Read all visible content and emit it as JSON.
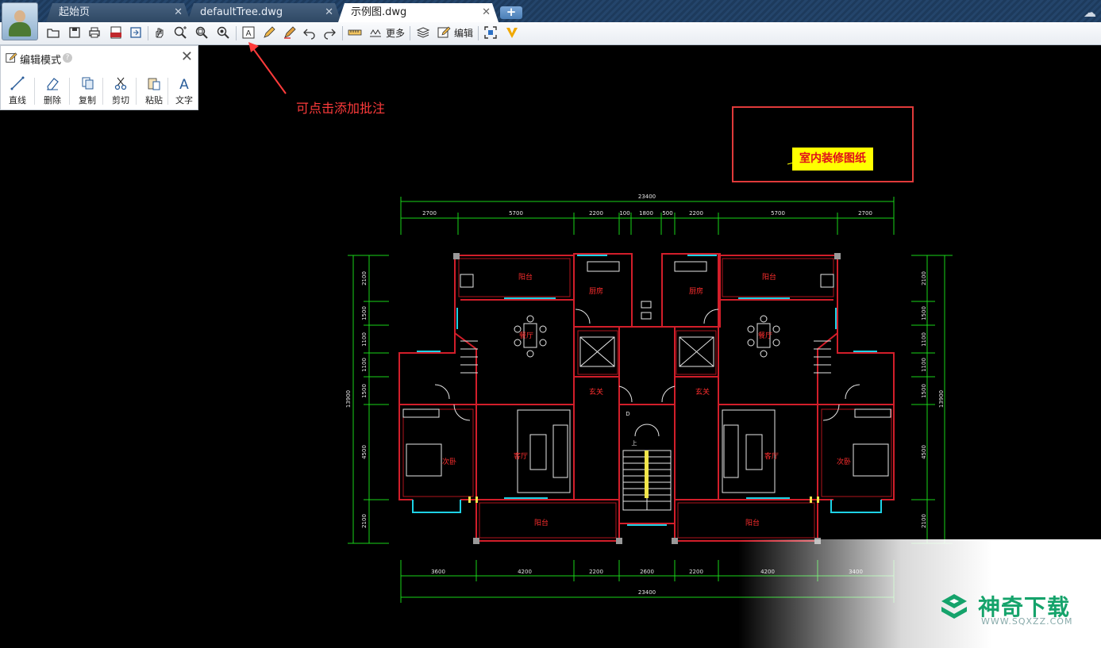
{
  "tabs": [
    {
      "label": "起始页",
      "close": "✕",
      "active": false
    },
    {
      "label": "defaultTree.dwg",
      "close": "✕",
      "active": false
    },
    {
      "label": "示例图.dwg",
      "close": "✕",
      "active": true
    }
  ],
  "toolbar": {
    "more_label": "更多",
    "edit_label": "编辑"
  },
  "edit_panel": {
    "title": "编辑模式",
    "help": "?",
    "close": "✕",
    "tools": [
      "直线",
      "删除",
      "复制",
      "剪切",
      "粘贴",
      "文字"
    ]
  },
  "annotation": {
    "hint": "可点击添加批注",
    "stamp": "室内装修图纸",
    "color": "#ff3b3b"
  },
  "drawing": {
    "top_total": "23400",
    "top_dims": [
      "2700",
      "5700",
      "2200",
      "100",
      "1800",
      "500",
      "2200",
      "5700",
      "2700"
    ],
    "bottom_total": "23400",
    "bottom_dims": [
      "3600",
      "4200",
      "2200",
      "2600",
      "2200",
      "4200",
      "3400"
    ],
    "left_total": "13900",
    "left_dims": [
      "2100",
      "1500",
      "1100",
      "1100",
      "1500",
      "4500",
      "2100"
    ],
    "right_total": "13900",
    "right_dims": [
      "2100",
      "1500",
      "1100",
      "1100",
      "1500",
      "4500",
      "2100"
    ],
    "rooms": {
      "balcony": "阳台",
      "kitchen": "厨房",
      "dining": "餐厅",
      "foyer": "玄关",
      "living": "客厅",
      "bedroom": "次卧",
      "door_d": "D",
      "up": "上"
    }
  },
  "watermark": {
    "name": "神奇下载",
    "url": "WWW.SQXZZ.COM"
  }
}
